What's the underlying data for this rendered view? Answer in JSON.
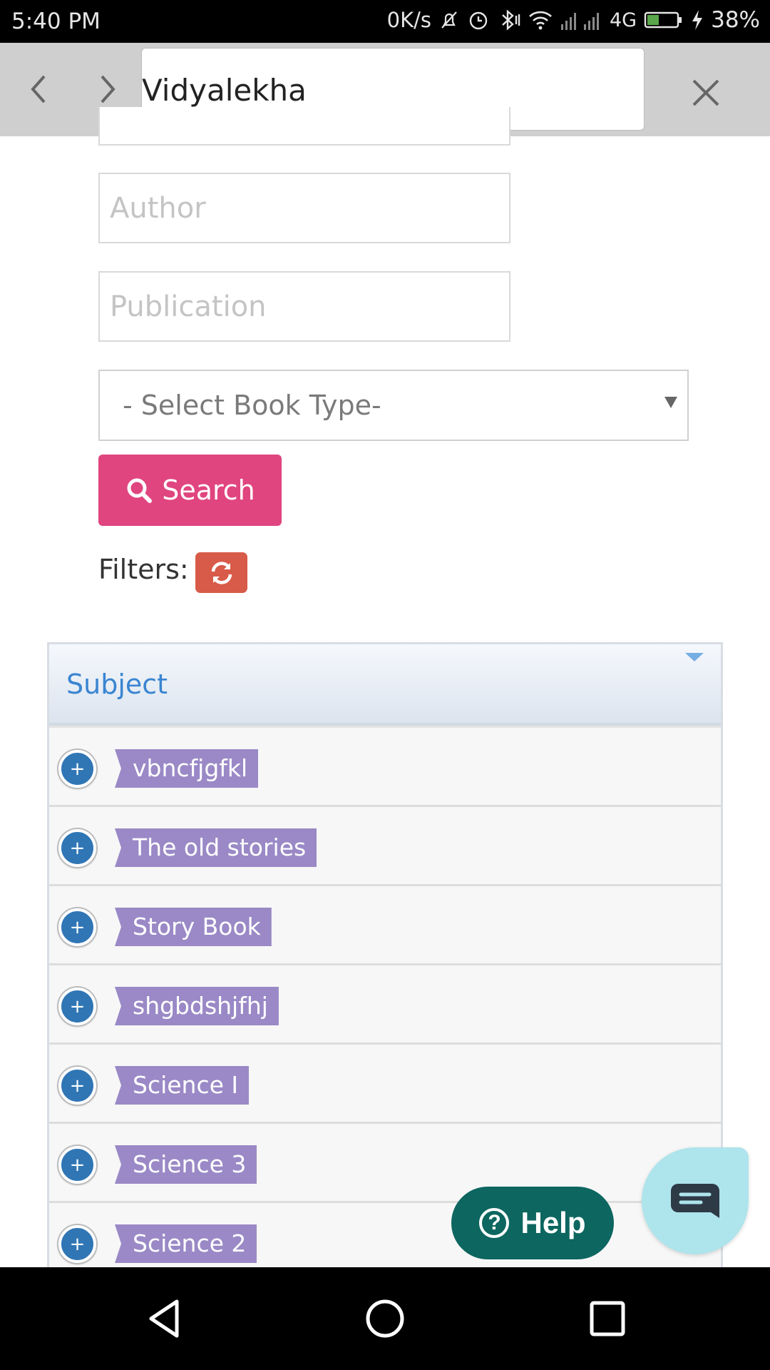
{
  "status_bar": {
    "time": "5:40 PM",
    "net_speed": "0K/s",
    "network": "4G",
    "battery": "38%"
  },
  "browser": {
    "url_text": "Vidyalekha"
  },
  "form": {
    "author_placeholder": "Author",
    "publication_placeholder": "Publication",
    "book_type_selected": "- Select Book Type-",
    "search_label": "Search",
    "filters_label": "Filters:"
  },
  "subject_panel": {
    "title": "Subject",
    "items": [
      {
        "label": "vbncfjgfkl"
      },
      {
        "label": "The old stories"
      },
      {
        "label": "Story Book"
      },
      {
        "label": "shgbdshjfhj"
      },
      {
        "label": "Science I"
      },
      {
        "label": "Science 3"
      },
      {
        "label": "Science 2"
      }
    ]
  },
  "floating": {
    "help_label": "Help"
  },
  "colors": {
    "search_button": "#e0457f",
    "refresh_button": "#d85a48",
    "tag": "#9a89c6",
    "plus_circle": "#3076b5",
    "help_button": "#0d6660",
    "chat_button": "#aee4ec",
    "panel_title": "#3a85d1"
  }
}
